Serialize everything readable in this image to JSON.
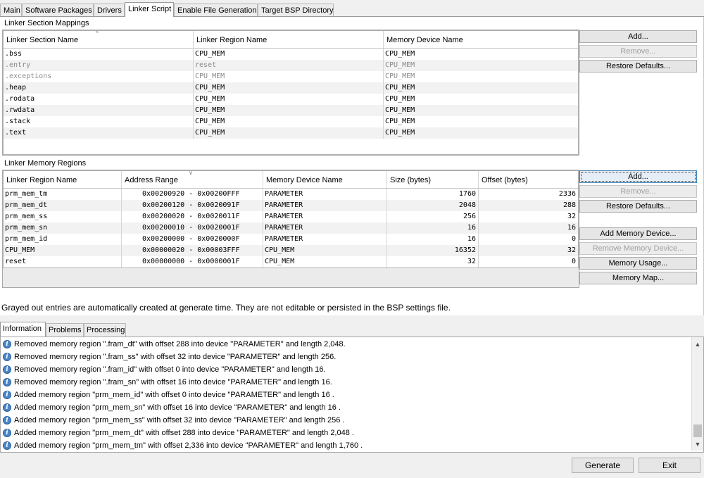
{
  "tabs": [
    {
      "label": "Main",
      "active": false
    },
    {
      "label": "Software Packages",
      "active": false
    },
    {
      "label": "Drivers",
      "active": false
    },
    {
      "label": "Linker Script",
      "active": true
    },
    {
      "label": "Enable File Generation",
      "active": false
    },
    {
      "label": "Target BSP Directory",
      "active": false
    }
  ],
  "section_mappings": {
    "title": "Linker Section Mappings",
    "columns": [
      "Linker Section Name",
      "Linker Region Name",
      "Memory Device Name"
    ],
    "rows": [
      {
        "section": ".bss",
        "region": "CPU_MEM",
        "device": "CPU_MEM",
        "grayed": false
      },
      {
        "section": ".entry",
        "region": "reset",
        "device": "CPU_MEM",
        "grayed": true
      },
      {
        "section": ".exceptions",
        "region": "CPU_MEM",
        "device": "CPU_MEM",
        "grayed": true
      },
      {
        "section": ".heap",
        "region": "CPU_MEM",
        "device": "CPU_MEM",
        "grayed": false
      },
      {
        "section": ".rodata",
        "region": "CPU_MEM",
        "device": "CPU_MEM",
        "grayed": false
      },
      {
        "section": ".rwdata",
        "region": "CPU_MEM",
        "device": "CPU_MEM",
        "grayed": false
      },
      {
        "section": ".stack",
        "region": "CPU_MEM",
        "device": "CPU_MEM",
        "grayed": false
      },
      {
        "section": ".text",
        "region": "CPU_MEM",
        "device": "CPU_MEM",
        "grayed": false
      }
    ],
    "buttons": {
      "add": "Add...",
      "remove": "Remove...",
      "restore": "Restore Defaults..."
    }
  },
  "memory_regions": {
    "title": "Linker Memory Regions",
    "columns": [
      "Linker Region Name",
      "Address Range",
      "Memory Device Name",
      "Size (bytes)",
      "Offset (bytes)"
    ],
    "rows": [
      {
        "region": "prm_mem_tm",
        "range": "0x00200920 - 0x00200FFF",
        "device": "PARAMETER",
        "size": "1760",
        "offset": "2336"
      },
      {
        "region": "prm_mem_dt",
        "range": "0x00200120 - 0x0020091F",
        "device": "PARAMETER",
        "size": "2048",
        "offset": "288"
      },
      {
        "region": "prm_mem_ss",
        "range": "0x00200020 - 0x0020011F",
        "device": "PARAMETER",
        "size": "256",
        "offset": "32"
      },
      {
        "region": "prm_mem_sn",
        "range": "0x00200010 - 0x0020001F",
        "device": "PARAMETER",
        "size": "16",
        "offset": "16"
      },
      {
        "region": "prm_mem_id",
        "range": "0x00200000 - 0x0020000F",
        "device": "PARAMETER",
        "size": "16",
        "offset": "0"
      },
      {
        "region": "CPU_MEM",
        "range": "0x00000020 - 0x00003FFF",
        "device": "CPU_MEM",
        "size": "16352",
        "offset": "32"
      },
      {
        "region": "reset",
        "range": "0x00000000 - 0x0000001F",
        "device": "CPU_MEM",
        "size": "32",
        "offset": "0"
      }
    ],
    "buttons": {
      "add": "Add...",
      "remove": "Remove...",
      "restore": "Restore Defaults...",
      "add_device": "Add Memory Device...",
      "remove_device": "Remove Memory Device...",
      "usage": "Memory Usage...",
      "map": "Memory Map..."
    }
  },
  "note": "Grayed out entries are automatically created at generate time. They are not editable or persisted in the BSP settings file.",
  "bottom_tabs": [
    {
      "label": "Information",
      "active": true
    },
    {
      "label": "Problems",
      "active": false
    },
    {
      "label": "Processing",
      "active": false
    }
  ],
  "messages": [
    "Removed memory region \".fram_dt\" with offset 288 into device \"PARAMETER\" and length 2,048.",
    "Removed memory region \".fram_ss\" with offset 32 into device \"PARAMETER\" and length 256.",
    "Removed memory region \".fram_id\" with offset 0 into device \"PARAMETER\" and length 16.",
    "Removed memory region \".fram_sn\" with offset 16 into device \"PARAMETER\" and length 16.",
    "Added memory region \"prm_mem_id\" with offset 0 into device \"PARAMETER\" and length 16 .",
    "Added memory region \"prm_mem_sn\" with offset 16 into device \"PARAMETER\" and length 16 .",
    "Added memory region \"prm_mem_ss\" with offset 32 into device \"PARAMETER\" and length 256 .",
    "Added memory region \"prm_mem_dt\" with offset 288 into device \"PARAMETER\" and length 2,048 .",
    "Added memory region \"prm_mem_tm\" with offset 2,336 into device \"PARAMETER\" and length 1,760 ."
  ],
  "icons": {
    "info": "info-icon",
    "scroll_up": "scroll-up-icon",
    "scroll_down": "scroll-down-icon",
    "sort": "sort-caret-icon"
  },
  "footer": {
    "generate": "Generate",
    "exit": "Exit"
  }
}
